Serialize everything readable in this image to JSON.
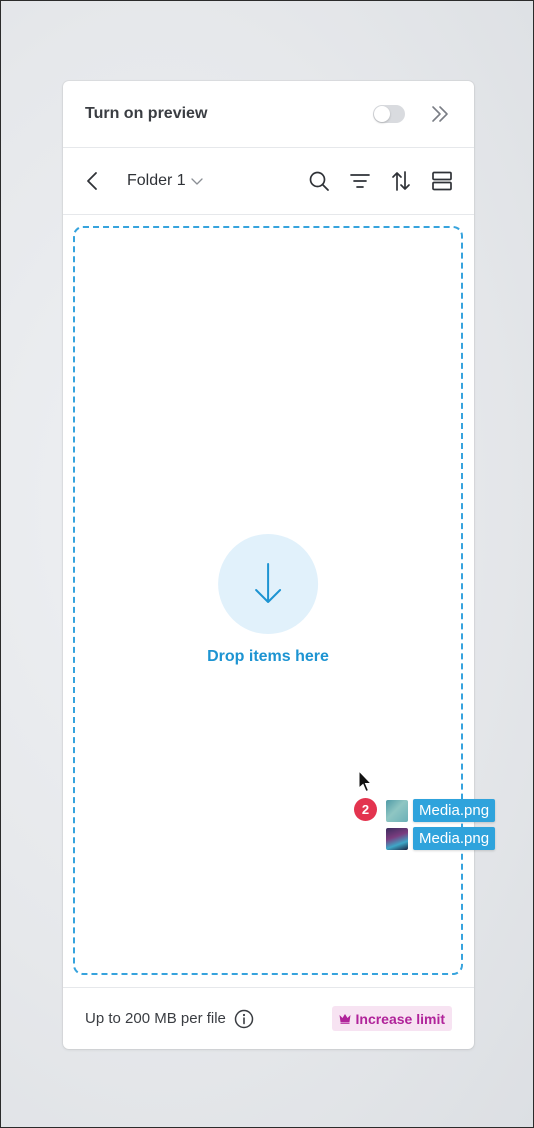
{
  "preview": {
    "title": "Turn on preview",
    "toggle_on": false
  },
  "toolbar": {
    "folder_name": "Folder 1"
  },
  "dropzone": {
    "label": "Drop items here",
    "border_color": "#36a3dd"
  },
  "footer": {
    "limit_text": "Up to 200 MB per file",
    "increase_label": "Increase limit"
  },
  "drag": {
    "count": "2",
    "files": [
      {
        "name": "Media.png",
        "thumb_icon": "image-thumbnail"
      },
      {
        "name": "Media.png",
        "thumb_icon": "image-thumbnail"
      }
    ]
  },
  "colors": {
    "accent": "#1d94d2",
    "badge": "#e3344f",
    "premium": "#b0239a"
  }
}
